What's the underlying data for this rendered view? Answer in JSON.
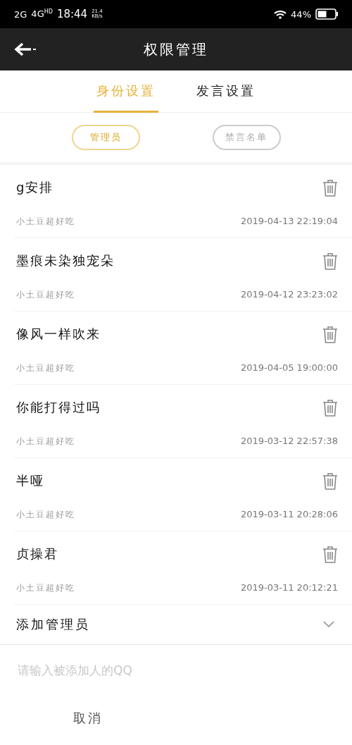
{
  "status_bar": {
    "network_1": "2G",
    "network_2": "4G",
    "network_2_badge": "HD",
    "time": "18:44",
    "speed_value": "21.4",
    "speed_unit": "KB/s",
    "battery": "44%"
  },
  "header": {
    "title": "权限管理"
  },
  "tabs": [
    {
      "label": "身份设置",
      "selected": true
    },
    {
      "label": "发言设置",
      "selected": false
    }
  ],
  "filters": [
    {
      "label": "管理员",
      "selected": true
    },
    {
      "label": "禁言名单",
      "selected": false
    }
  ],
  "members": [
    {
      "name": "g安排",
      "added_by": "小土豆超好吃",
      "time": "2019-04-13 22:19:04"
    },
    {
      "name": "墨痕未染独宠朵",
      "added_by": "小土豆超好吃",
      "time": "2019-04-12 23:23:02"
    },
    {
      "name": "像风一样吹来",
      "added_by": "小土豆超好吃",
      "time": "2019-04-05 19:00:00"
    },
    {
      "name": "你能打得过吗",
      "added_by": "小土豆超好吃",
      "time": "2019-03-12 22:57:38"
    },
    {
      "name": "半哑",
      "added_by": "小土豆超好吃",
      "time": "2019-03-11 20:28:06"
    },
    {
      "name": "贞操君",
      "added_by": "小土豆超好吃",
      "time": "2019-03-11 20:12:21"
    }
  ],
  "add_panel": {
    "title": "添加管理员",
    "expanded": true,
    "placeholder": "请输入被添加人的QQ",
    "cancel": "取消"
  }
}
